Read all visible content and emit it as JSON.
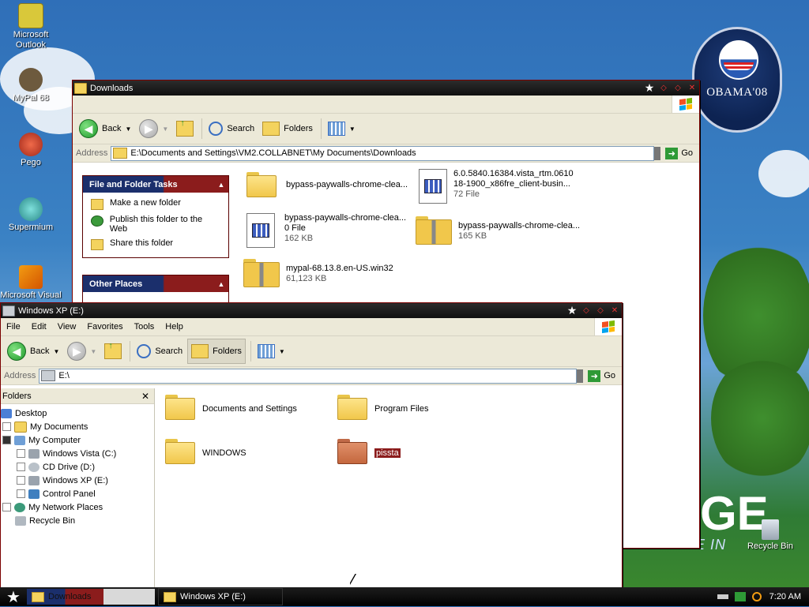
{
  "desktop": {
    "icons": [
      {
        "label": "Microsoft Outlook",
        "color": "#d9c83a"
      },
      {
        "label": "MyPal 68",
        "color": "#6d5a3e"
      },
      {
        "label": "Pego",
        "color": "#c0392b"
      },
      {
        "label": "Supermium",
        "color": "#3bb5b0"
      },
      {
        "label": "Microsoft Visual",
        "color": "#d35400"
      }
    ],
    "recycle_bin": "Recycle Bin",
    "badge_text": "OBAMA'08",
    "banner_big": "GE",
    "banner_small": "E IN"
  },
  "downloads_window": {
    "title": "Downloads",
    "toolbar": {
      "back": "Back",
      "search": "Search",
      "folders": "Folders"
    },
    "address_label": "Address",
    "address_value": "E:\\Documents and Settings\\VM2.COLLABNET\\My Documents\\Downloads",
    "go": "Go",
    "tasks_pane": {
      "title": "File and Folder Tasks",
      "items": [
        "Make a new folder",
        "Publish this folder to the Web",
        "Share this folder"
      ]
    },
    "other_places_title": "Other Places",
    "files": [
      {
        "name": "bypass-paywalls-chrome-clea...",
        "meta1": "",
        "meta2": "",
        "type": "folder"
      },
      {
        "name": "6.0.5840.16384.vista_rtm.0610",
        "meta1": "18-1900_x86fre_client-busin...",
        "meta2": "72 File",
        "type": "doc"
      },
      {
        "name": "bypass-paywalls-chrome-clea...",
        "meta1": "0 File",
        "meta2": "162 KB",
        "type": "doc"
      },
      {
        "name": "bypass-paywalls-chrome-clea...",
        "meta1": "165 KB",
        "meta2": "",
        "type": "zip"
      },
      {
        "name": "mypal-68.13.8.en-US.win32",
        "meta1": "61,123 KB",
        "meta2": "",
        "type": "zip"
      }
    ]
  },
  "explorer_window": {
    "title": "Windows XP (E:)",
    "menu": [
      "File",
      "Edit",
      "View",
      "Favorites",
      "Tools",
      "Help"
    ],
    "toolbar": {
      "back": "Back",
      "search": "Search",
      "folders": "Folders"
    },
    "address_label": "Address",
    "address_value": "E:\\",
    "go": "Go",
    "tree": {
      "header": "Folders",
      "items": [
        {
          "label": "Desktop",
          "indent": 0,
          "box": "",
          "icon": "#4a7fd6"
        },
        {
          "label": "My Documents",
          "indent": 1,
          "box": "",
          "icon": "#f4d35e"
        },
        {
          "label": "My Computer",
          "indent": 1,
          "box": "-",
          "icon": "#6f9fd6"
        },
        {
          "label": "Windows Vista (C:)",
          "indent": 2,
          "box": "",
          "icon": "#9aa3ad"
        },
        {
          "label": "CD Drive (D:)",
          "indent": 2,
          "box": "",
          "icon": "#b9c1c9"
        },
        {
          "label": "Windows XP (E:)",
          "indent": 2,
          "box": "",
          "icon": "#9aa3ad"
        },
        {
          "label": "Control Panel",
          "indent": 2,
          "box": "",
          "icon": "#3f7fbf"
        },
        {
          "label": "My Network Places",
          "indent": 1,
          "box": "",
          "icon": "#3b9a7a"
        },
        {
          "label": "Recycle Bin",
          "indent": 1,
          "box": "",
          "icon": "#b0b8c0"
        }
      ]
    },
    "folders": [
      {
        "name": "Documents and Settings",
        "style": "normal"
      },
      {
        "name": "Program Files",
        "style": "normal"
      },
      {
        "name": "WINDOWS",
        "style": "normal"
      },
      {
        "name": "pissta",
        "style": "selected"
      }
    ]
  },
  "taskbar": {
    "tasks": [
      "Downloads",
      "Windows XP (E:)"
    ],
    "clock": "7:20 AM"
  },
  "colors": {
    "title_bar": "#101010",
    "window_border": "#7a0000",
    "selection": "#8b1c1c"
  }
}
